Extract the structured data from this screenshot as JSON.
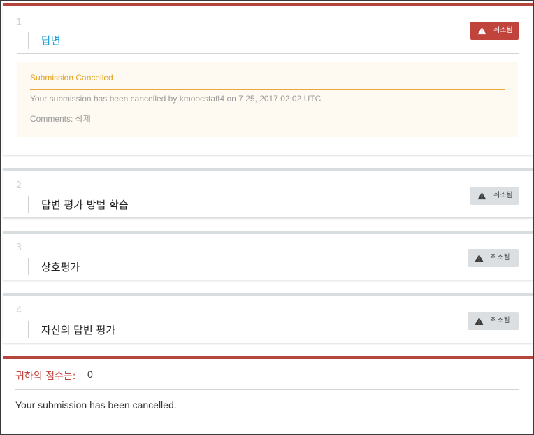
{
  "steps": [
    {
      "number": "1",
      "title": "답변",
      "status": "취소됨",
      "cancellation": {
        "title": "Submission Cancelled",
        "message": "Your submission has been cancelled by kmoocstaff4 on 7 25, 2017 02:02 UTC",
        "comments": "Comments: 삭제"
      }
    },
    {
      "number": "2",
      "title": "답변 평가 방법 학습",
      "status": "취소됨"
    },
    {
      "number": "3",
      "title": "상호평가",
      "status": "취소됨"
    },
    {
      "number": "4",
      "title": "자신의 답변 평가",
      "status": "취소됨"
    }
  ],
  "grade": {
    "label": "귀하의 점수는:",
    "value": "0",
    "message": "Your submission has been cancelled."
  },
  "colors": {
    "accent_red": "#c0443c",
    "link_blue": "#1f9fd5",
    "cancel_orange": "#e4a01e",
    "badge_gray": "#dcdfe2"
  },
  "icons": {
    "status": "warning-triangle-icon"
  }
}
